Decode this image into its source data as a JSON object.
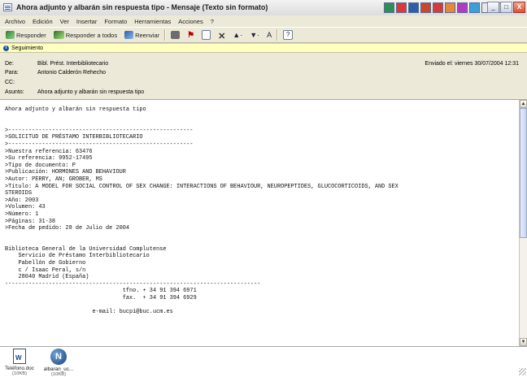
{
  "window": {
    "title": "Ahora adjunto y albarán sin respuesta tipo - Mensaje (Texto sin formato)",
    "controls": [
      "_",
      "□",
      "X"
    ]
  },
  "menu": [
    "Archivo",
    "Edición",
    "Ver",
    "Insertar",
    "Formato",
    "Herramientas",
    "Acciones",
    "?"
  ],
  "toolbar": {
    "reply": "Responder",
    "reply_all": "Responder a todos",
    "forward": "Reenviar"
  },
  "info_bar": {
    "icon": "info-icon",
    "text": "Seguimiento"
  },
  "header": {
    "from_label": "De:",
    "from": "Bibl. Prést. Interbibliotecario",
    "to_label": "Para:",
    "to": "Antonio Calderón Rehecho",
    "cc_label": "CC:",
    "cc": "",
    "subject_label": "Asunto:",
    "subject": "Ahora adjunto y albarán sin respuesta tipo",
    "sent": "Enviado el: viernes 30/07/2004 12:31"
  },
  "body": {
    "text": "Ahora adjunto y albarán sin respuesta tipo\n\n\n>-------------------------------------------------------\n>SOLICITUD DE PRÉSTAMO INTERBIBLIOTECARIO\n>-------------------------------------------------------\n>Nuestra referencia: 63476\n>Su referencia: 9952-17495\n>Tipo de documento: P\n>Publicación: HORMONES AND BEHAVIOUR\n>Autor: PERRY, AN; GROBER, MS\n>Título: A MODEL FOR SOCIAL CONTROL OF SEX CHANGE: INTERACTIONS OF BEHAVIOUR, NEUROPEPTIDES, GLUCOCORTICOIDS, AND SEX\nSTEROIDS\n>Año: 2003\n>Volumen: 43\n>Número: 1\n>Páginas: 31-38\n>Fecha de pedido: 28 de Julio de 2004\n\n\nBiblioteca General de la Universidad Complutense\n    Servicio de Préstamo Interbibliotecario\n    Pabellón de Gobierno\n    c / Isaac Peral, s/n\n    28040 Madrid (España)\n----------------------------------------------------------------------------\n                                   tfno. + 34 91 394 6971\n                                   fax.  + 34 91 394 6929\n\n                          e-mail: bucpi@buc.ucm.es"
  },
  "attachments": [
    {
      "name": "Teléfono.doc",
      "size": "(10KB)",
      "icon": "word-document-icon"
    },
    {
      "name": "albaran_uc...",
      "size": "(10KB)",
      "icon": "netscape-icon"
    }
  ]
}
